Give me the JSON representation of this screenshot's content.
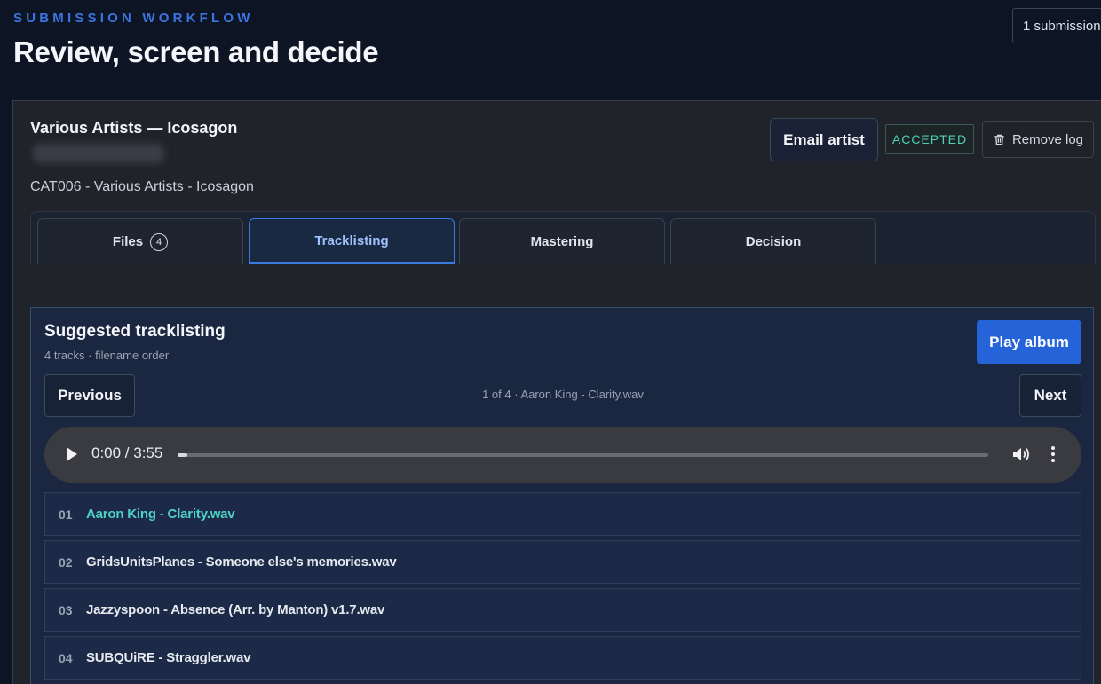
{
  "header": {
    "eyebrow": "SUBMISSION WORKFLOW",
    "title": "Review, screen and decide",
    "submission_count": "1 submission"
  },
  "submission": {
    "title": "Various Artists — Icosagon",
    "catalog_line": "CAT006 - Various Artists - Icosagon",
    "email_button": "Email artist",
    "status_badge": "ACCEPTED",
    "remove_button": "Remove log"
  },
  "tabs": [
    {
      "label": "Files",
      "count": "4"
    },
    {
      "label": "Tracklisting"
    },
    {
      "label": "Mastering"
    },
    {
      "label": "Decision"
    }
  ],
  "active_tab": "Tracklisting",
  "tracklisting": {
    "title": "Suggested tracklisting",
    "meta": "4 tracks · filename order",
    "play_album": "Play album",
    "previous": "Previous",
    "next": "Next",
    "now_playing": "1 of 4 · Aaron King - Clarity.wav",
    "player": {
      "time": "0:00 / 3:55",
      "progress": 0.0
    },
    "tracks": [
      {
        "num": "01",
        "name": "Aaron King - Clarity.wav",
        "current": true
      },
      {
        "num": "02",
        "name": "GridsUnitsPlanes - Someone else's memories.wav",
        "current": false
      },
      {
        "num": "03",
        "name": "Jazzyspoon - Absence (Arr. by Manton) v1.7.wav",
        "current": false
      },
      {
        "num": "04",
        "name": "SUBQUiRE - Straggler.wav",
        "current": false
      }
    ]
  },
  "colors": {
    "accent": "#2563d8",
    "accepted": "#4fd1b5",
    "current_track": "#4fd1c5"
  }
}
